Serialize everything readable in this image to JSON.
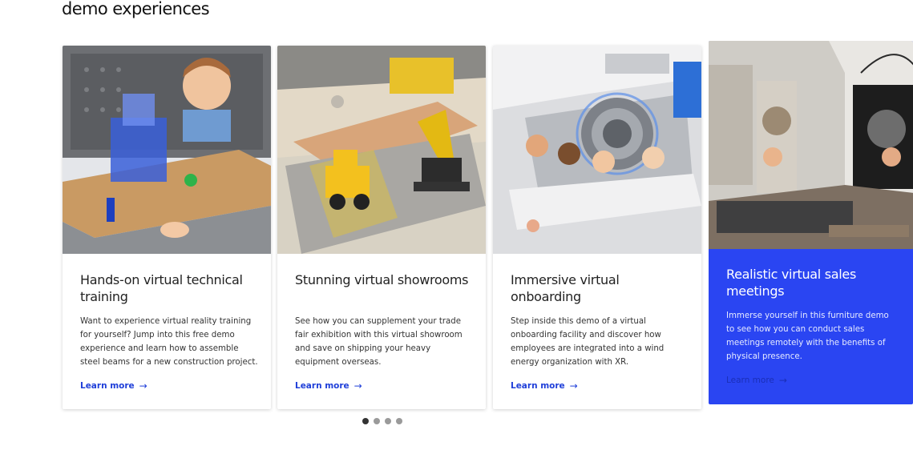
{
  "section": {
    "title": "demo experiences"
  },
  "cards": [
    {
      "title": "Hands-on virtual technical training",
      "description": "Want to experience virtual reality training for yourself? Jump into this free demo experience and learn how to assemble steel beams for a new construction project.",
      "link_label": "Learn more",
      "link_arrow": "→"
    },
    {
      "title": "Stunning virtual showrooms",
      "description": "See how you can supplement your trade fair exhibition with this virtual showroom and save on shipping your heavy equipment overseas.",
      "link_label": "Learn more",
      "link_arrow": "→"
    },
    {
      "title": "Immersive virtual onboarding",
      "description": "Step inside this demo of a virtual onboarding facility and discover how employees are integrated into a wind energy organization with XR.",
      "link_label": "Learn more",
      "link_arrow": "→"
    },
    {
      "title": "Realistic virtual sales meetings",
      "description": "Immerse yourself in this furniture demo to see how you can conduct sales meetings remotely with the benefits of physical presence.",
      "link_label": "Learn more",
      "link_arrow": "→"
    }
  ],
  "carousel": {
    "page_count": 4,
    "active_page": 1
  },
  "colors": {
    "accent": "#2a45f2",
    "link": "#1f3fd9"
  }
}
